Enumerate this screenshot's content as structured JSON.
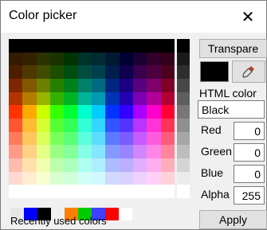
{
  "window": {
    "title": "Color picker",
    "close_glyph": "✕"
  },
  "palette": {
    "rows": [
      [
        "#000000",
        "#000000",
        "#000000",
        "#000000",
        "#000000",
        "#000000",
        "#000000",
        "#000000",
        "#000000",
        "#000000",
        "#000000",
        "#000000"
      ],
      [
        "#331a00",
        "#332200",
        "#2b3300",
        "#1a3300",
        "#003300",
        "#00332b",
        "#002b33",
        "#001a33",
        "#000033",
        "#1a0033",
        "#33002b",
        "#33001a"
      ],
      [
        "#4d1d00",
        "#4d3a00",
        "#404d00",
        "#1d4d00",
        "#004d10",
        "#004d40",
        "#00404d",
        "#001d4d",
        "#10004d",
        "#3a004d",
        "#4d0040",
        "#4d001d"
      ],
      [
        "#802600",
        "#805900",
        "#6b8000",
        "#268000",
        "#00801a",
        "#00806b",
        "#006b80",
        "#002680",
        "#1a0080",
        "#590080",
        "#80006b",
        "#800026"
      ],
      [
        "#b33300",
        "#b37d00",
        "#99b300",
        "#33b300",
        "#00b324",
        "#00b399",
        "#0099b3",
        "#0033b3",
        "#2400b3",
        "#7d00b3",
        "#b30099",
        "#b30033"
      ],
      [
        "#ff3300",
        "#ffaa00",
        "#ccff00",
        "#33ff00",
        "#00ff33",
        "#00ffcc",
        "#00ccff",
        "#0033ff",
        "#3300ff",
        "#aa00ff",
        "#ff00cc",
        "#ff0033"
      ],
      [
        "#ff5533",
        "#ffbb33",
        "#d6ff33",
        "#55ff33",
        "#33ff55",
        "#33ffd6",
        "#33d6ff",
        "#3355ff",
        "#5533ff",
        "#bb33ff",
        "#ff33d6",
        "#ff3355"
      ],
      [
        "#ff7a5c",
        "#ffc65c",
        "#ddff5c",
        "#7aff5c",
        "#5cff7a",
        "#5cffdd",
        "#5cddff",
        "#5c7aff",
        "#7a5cff",
        "#c65cff",
        "#ff5cdd",
        "#ff5c7a"
      ],
      [
        "#ff9a85",
        "#ffd285",
        "#e6ff85",
        "#9aff85",
        "#85ff9a",
        "#85ffe6",
        "#85e6ff",
        "#859aff",
        "#9a85ff",
        "#d285ff",
        "#ff85e6",
        "#ff859a"
      ],
      [
        "#ffbbad",
        "#ffe0ad",
        "#efffad",
        "#bbffad",
        "#adffbb",
        "#adffef",
        "#adefff",
        "#adbbff",
        "#bbadff",
        "#e0adff",
        "#ffadef",
        "#ffadbb"
      ],
      [
        "#ffd9d1",
        "#ffeed1",
        "#f7ffd1",
        "#d9ffd1",
        "#d1ffd9",
        "#d1fff7",
        "#d1f7ff",
        "#d1d9ff",
        "#d9d1ff",
        "#eed1ff",
        "#ffd1f7",
        "#ffd1d9"
      ],
      [
        "#ffffff",
        "#ffffff",
        "#ffffff",
        "#ffffff",
        "#ffffff",
        "#ffffff",
        "#ffffff",
        "#ffffff",
        "#ffffff",
        "#ffffff",
        "#ffffff",
        "#ffffff"
      ]
    ],
    "grays": [
      "#000000",
      "#1a1a1a",
      "#2e2e2e",
      "#474747",
      "#5e5e5e",
      "#777777",
      "#8f8f8f",
      "#a6a6a6",
      "#bdbdbd",
      "#d4d4d4",
      "#ebebeb",
      "#ffffff"
    ]
  },
  "recent": {
    "label": "Recently used colors",
    "colors": [
      "#e6e6e6",
      "#0000ff",
      "#000000",
      null,
      "#ff8000",
      "#00cc00",
      "#4040ff",
      "#ff0000",
      "#ffffff"
    ]
  },
  "controls": {
    "transparent_label": "Transpare",
    "eyedropper_icon": "eyedropper-icon",
    "current_color": "#000000",
    "html_color_label": "HTML color",
    "html_color_value": "Black",
    "red_label": "Red",
    "red_value": "0",
    "green_label": "Green",
    "green_value": "0",
    "blue_label": "Blue",
    "blue_value": "0",
    "alpha_label": "Alpha",
    "alpha_value": "255",
    "apply_label": "Apply"
  }
}
